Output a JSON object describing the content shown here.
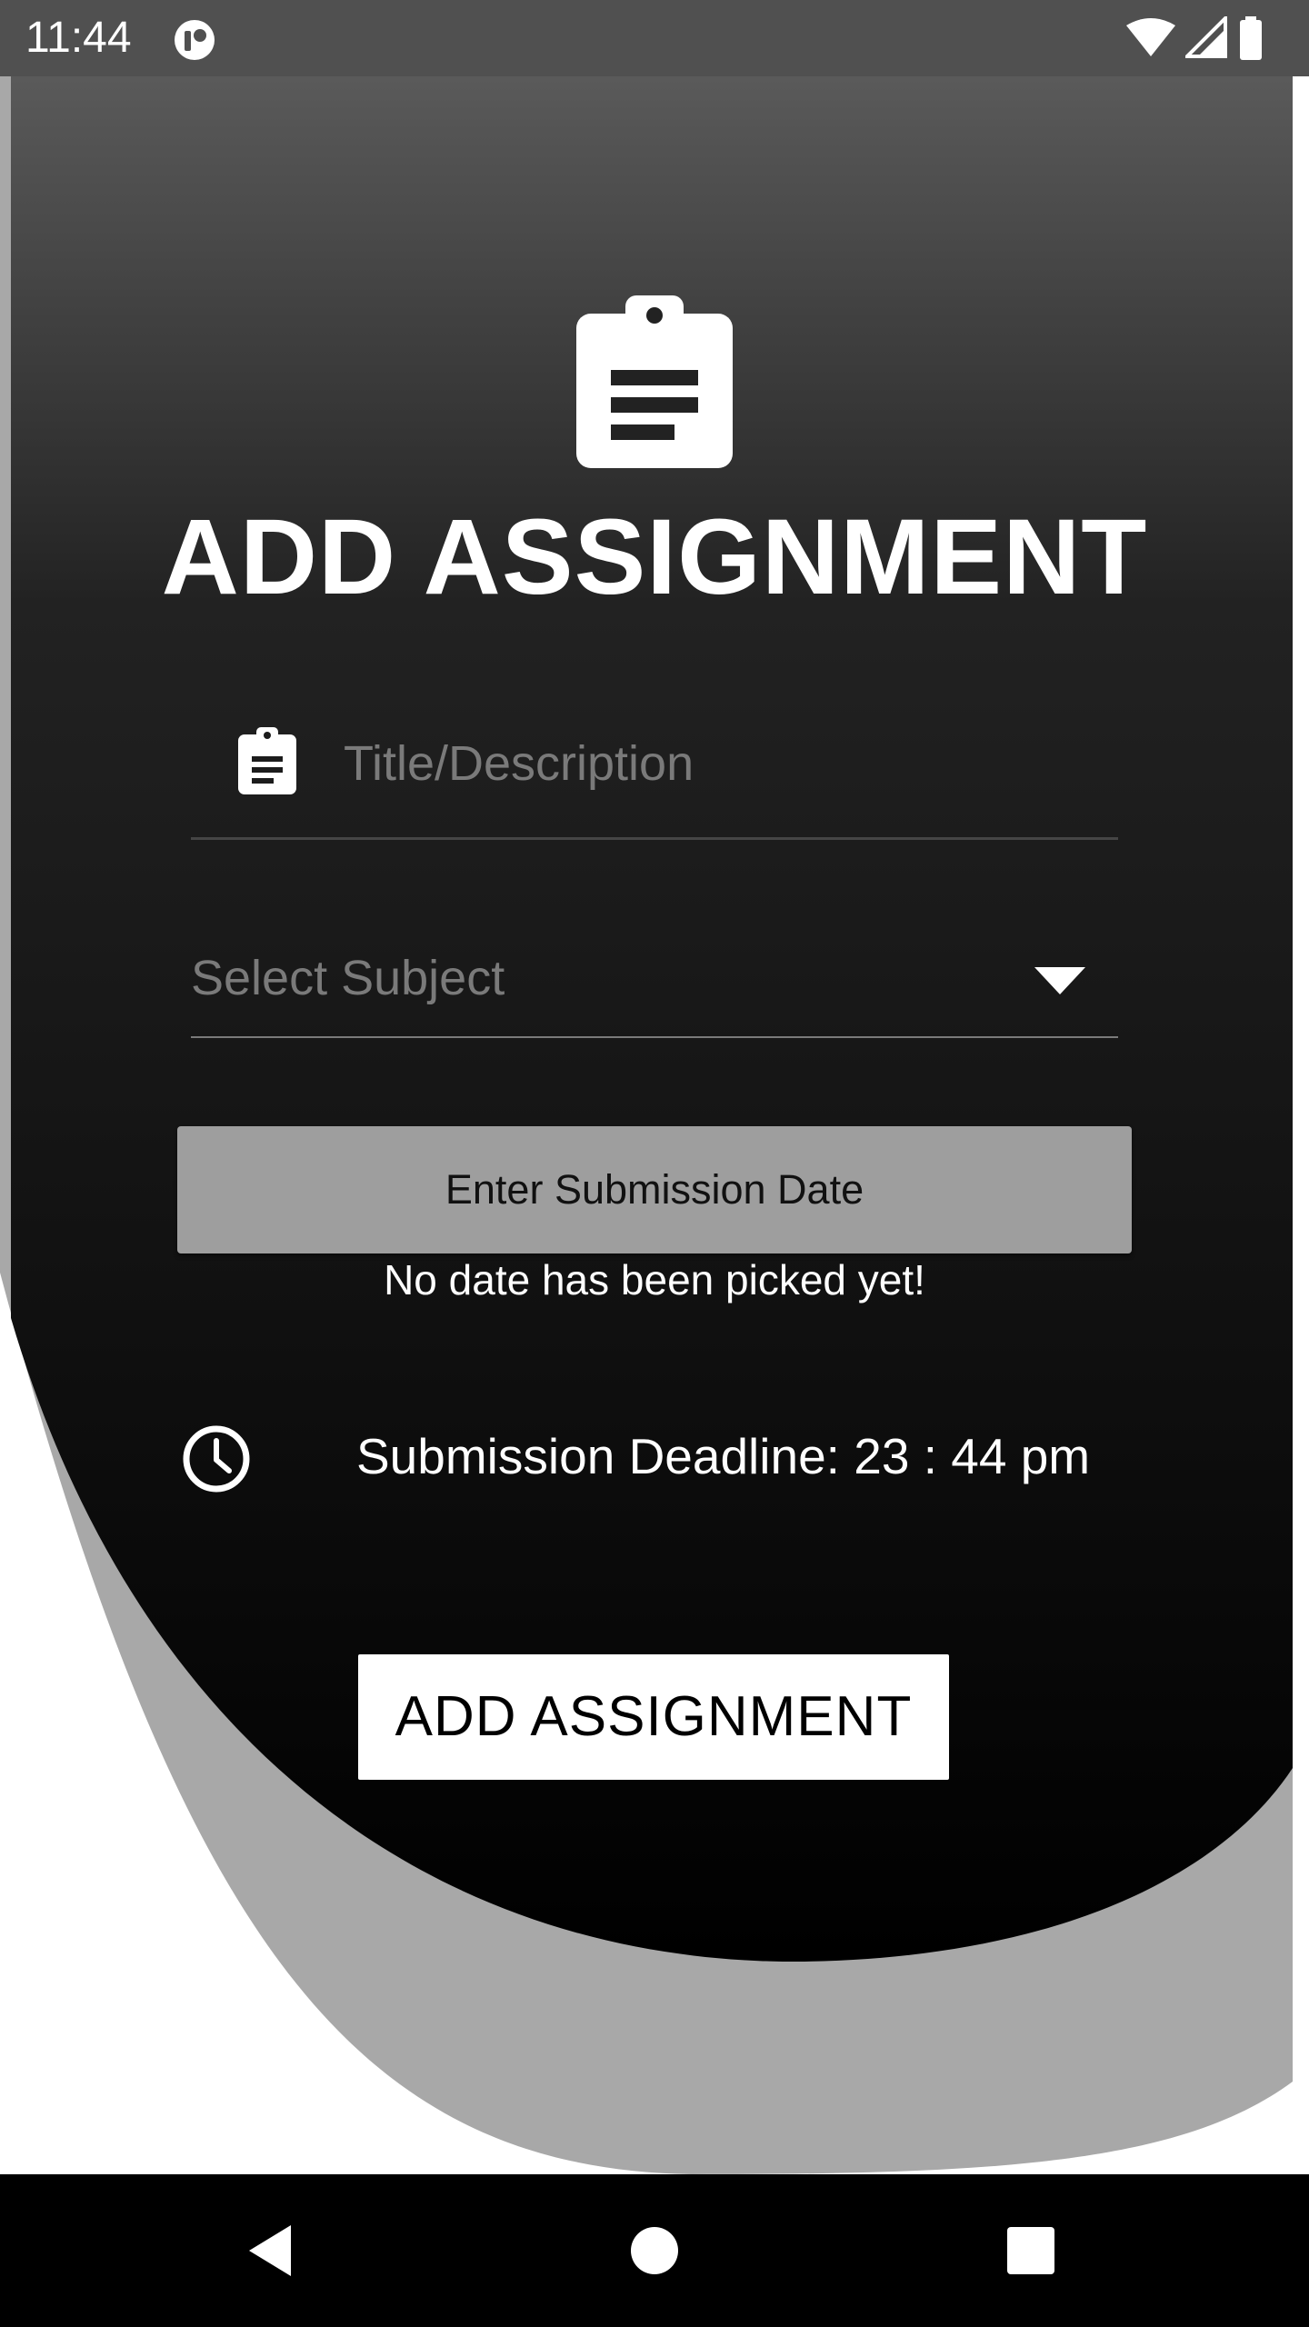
{
  "status_bar": {
    "time": "11:44",
    "app_icon": "app-notification-icon",
    "icons": [
      "wifi-icon",
      "cell-signal-icon",
      "battery-icon"
    ]
  },
  "header": {
    "icon": "clipboard-icon",
    "title": "ADD ASSIGNMENT"
  },
  "form": {
    "title_field": {
      "icon": "clipboard-icon",
      "placeholder": "Title/Description",
      "value": ""
    },
    "subject_select": {
      "placeholder": "Select Subject",
      "icon": "dropdown-arrow-icon"
    },
    "date_button": {
      "label": "Enter Submission Date"
    },
    "date_status": "No date has been picked yet!",
    "deadline": {
      "icon": "clock-icon",
      "text": "Submission Deadline: 23 : 44 pm"
    },
    "submit_button": {
      "label": "ADD ASSIGNMENT"
    }
  },
  "nav_bar": {
    "buttons": [
      "back-icon",
      "home-icon",
      "recents-icon"
    ]
  },
  "colors": {
    "background_top": "#5a5a5a",
    "background_bottom": "#000000",
    "shadow_shape": "#a8a8a8",
    "date_button": "#9e9e9e",
    "text": "#ffffff",
    "placeholder": "#7a7a7a"
  }
}
